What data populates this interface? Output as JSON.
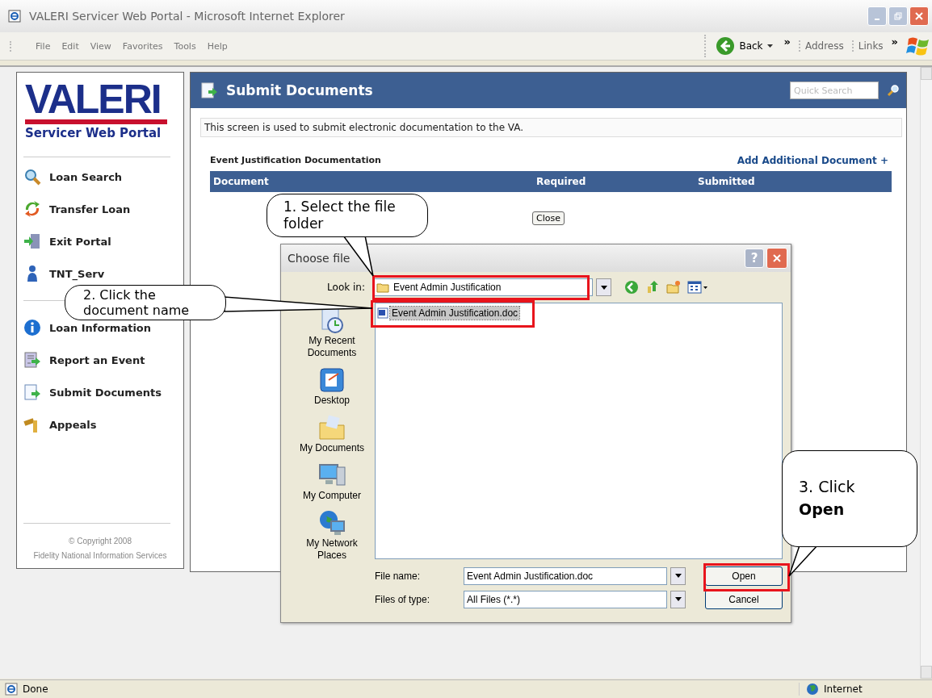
{
  "window": {
    "title": "VALERI Servicer Web Portal - Microsoft Internet Explorer"
  },
  "menu": [
    "File",
    "Edit",
    "View",
    "Favorites",
    "Tools",
    "Help"
  ],
  "toolbar": {
    "back": "Back",
    "chevron_1": "»",
    "address": "Address",
    "links": "Links",
    "chevron_2": "»"
  },
  "sidebar": {
    "logo": "VALERI",
    "subtitle": "Servicer Web Portal",
    "sections": [
      {
        "items": [
          {
            "label": "Loan Search"
          },
          {
            "label": "Transfer Loan"
          },
          {
            "label": "Exit Portal"
          },
          {
            "label": "TNT_Serv"
          }
        ]
      },
      {
        "items": [
          {
            "label": "Loan Information"
          },
          {
            "label": "Report an Event"
          },
          {
            "label": "Submit Documents"
          },
          {
            "label": "Appeals"
          }
        ]
      }
    ],
    "copyright": [
      "© Copyright 2008",
      "Fidelity National Information Services"
    ]
  },
  "page": {
    "title": "Submit Documents",
    "quick_search_placeholder": "Quick Search",
    "description": "This screen is used to submit electronic documentation to the VA.",
    "section_label": "Event Justification Documentation",
    "add_link": "Add Additional Document +",
    "columns": [
      "Document",
      "Required",
      "Submitted"
    ],
    "close": "Close"
  },
  "dialog": {
    "title": "Choose file",
    "help": "?",
    "look_in_label": "Look in:",
    "look_in_value": "Event Admin Justification",
    "places": [
      {
        "label": "My Recent Documents"
      },
      {
        "label": "Desktop"
      },
      {
        "label": "My Documents"
      },
      {
        "label": "My Computer"
      },
      {
        "label": "My Network Places"
      }
    ],
    "files": [
      {
        "name": "Event Admin Justification.doc",
        "selected": true
      }
    ],
    "file_name_label": "File name:",
    "file_name_value": "Event Admin Justification.doc",
    "file_type_label": "Files of type:",
    "file_type_value": "All Files (*.*)",
    "open": "Open",
    "cancel": "Cancel"
  },
  "callouts": [
    {
      "text": "1. Select the file folder"
    },
    {
      "text": "2. Click the document name"
    },
    {
      "text": "3. Click **Open**"
    }
  ],
  "status_bar": {
    "status": "Done",
    "zone": "Internet"
  }
}
